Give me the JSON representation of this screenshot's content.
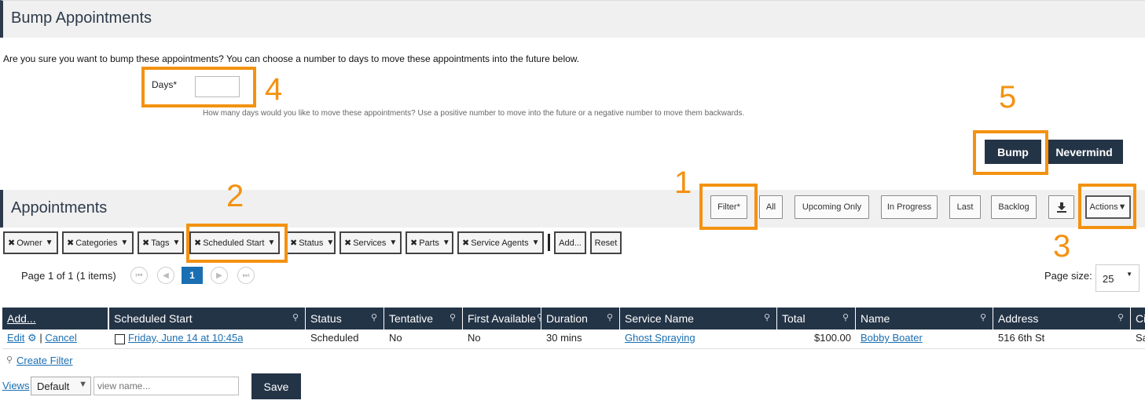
{
  "bump_panel": {
    "title": "Bump Appointments",
    "description": "Are you sure you want to bump these appointments? You can choose a number to days to move these appointments into the future below.",
    "days_label": "Days*",
    "days_value": "",
    "days_help": "How many days would you like to move these appointments? Use a positive number to move into the future or a negative number to move them backwards.",
    "bump_label": "Bump",
    "nevermind_label": "Nevermind"
  },
  "appointments_panel": {
    "title": "Appointments",
    "filter_buttons": [
      "Filter*",
      "All",
      "Upcoming Only",
      "In Progress",
      "Last",
      "Backlog"
    ],
    "download_icon": "download-icon",
    "actions_label": "Actions▼"
  },
  "filter_chips": [
    {
      "label": "Owner"
    },
    {
      "label": "Categories"
    },
    {
      "label": "Tags"
    },
    {
      "label": "Scheduled Start"
    },
    {
      "label": "Status"
    },
    {
      "label": "Services"
    },
    {
      "label": "Parts"
    },
    {
      "label": "Service Agents"
    }
  ],
  "chip_actions": {
    "add": "Add...",
    "reset": "Reset"
  },
  "pager": {
    "summary": "Page 1 of 1 (1 items)",
    "current_page": "1",
    "page_size_label": "Page size:",
    "page_size_value": "25"
  },
  "table": {
    "columns": [
      "Add...",
      "Scheduled Start",
      "Status",
      "Tentative",
      "First Available",
      "Duration",
      "Service Name",
      "Total",
      "Name",
      "Address",
      "Ci"
    ],
    "row": {
      "edit": "Edit",
      "separator": "|",
      "cancel": "Cancel",
      "scheduled_start": "Friday, June 14 at 10:45a",
      "status": "Scheduled",
      "tentative": "No",
      "first_available": "No",
      "duration": "30 mins",
      "service_name": "Ghost Spraying",
      "total": "$100.00",
      "name": "Bobby Boater",
      "address": "516 6th St",
      "city": "Sa"
    }
  },
  "footer": {
    "create_filter": "Create Filter",
    "views_label": "Views",
    "view_select": "Default",
    "view_name_placeholder": "view name...",
    "save_label": "Save"
  },
  "annotations": [
    "1",
    "2",
    "3",
    "4",
    "5"
  ],
  "colors": {
    "accent": "#f39211",
    "header_dark": "#243447",
    "link": "#1a6fb3"
  }
}
